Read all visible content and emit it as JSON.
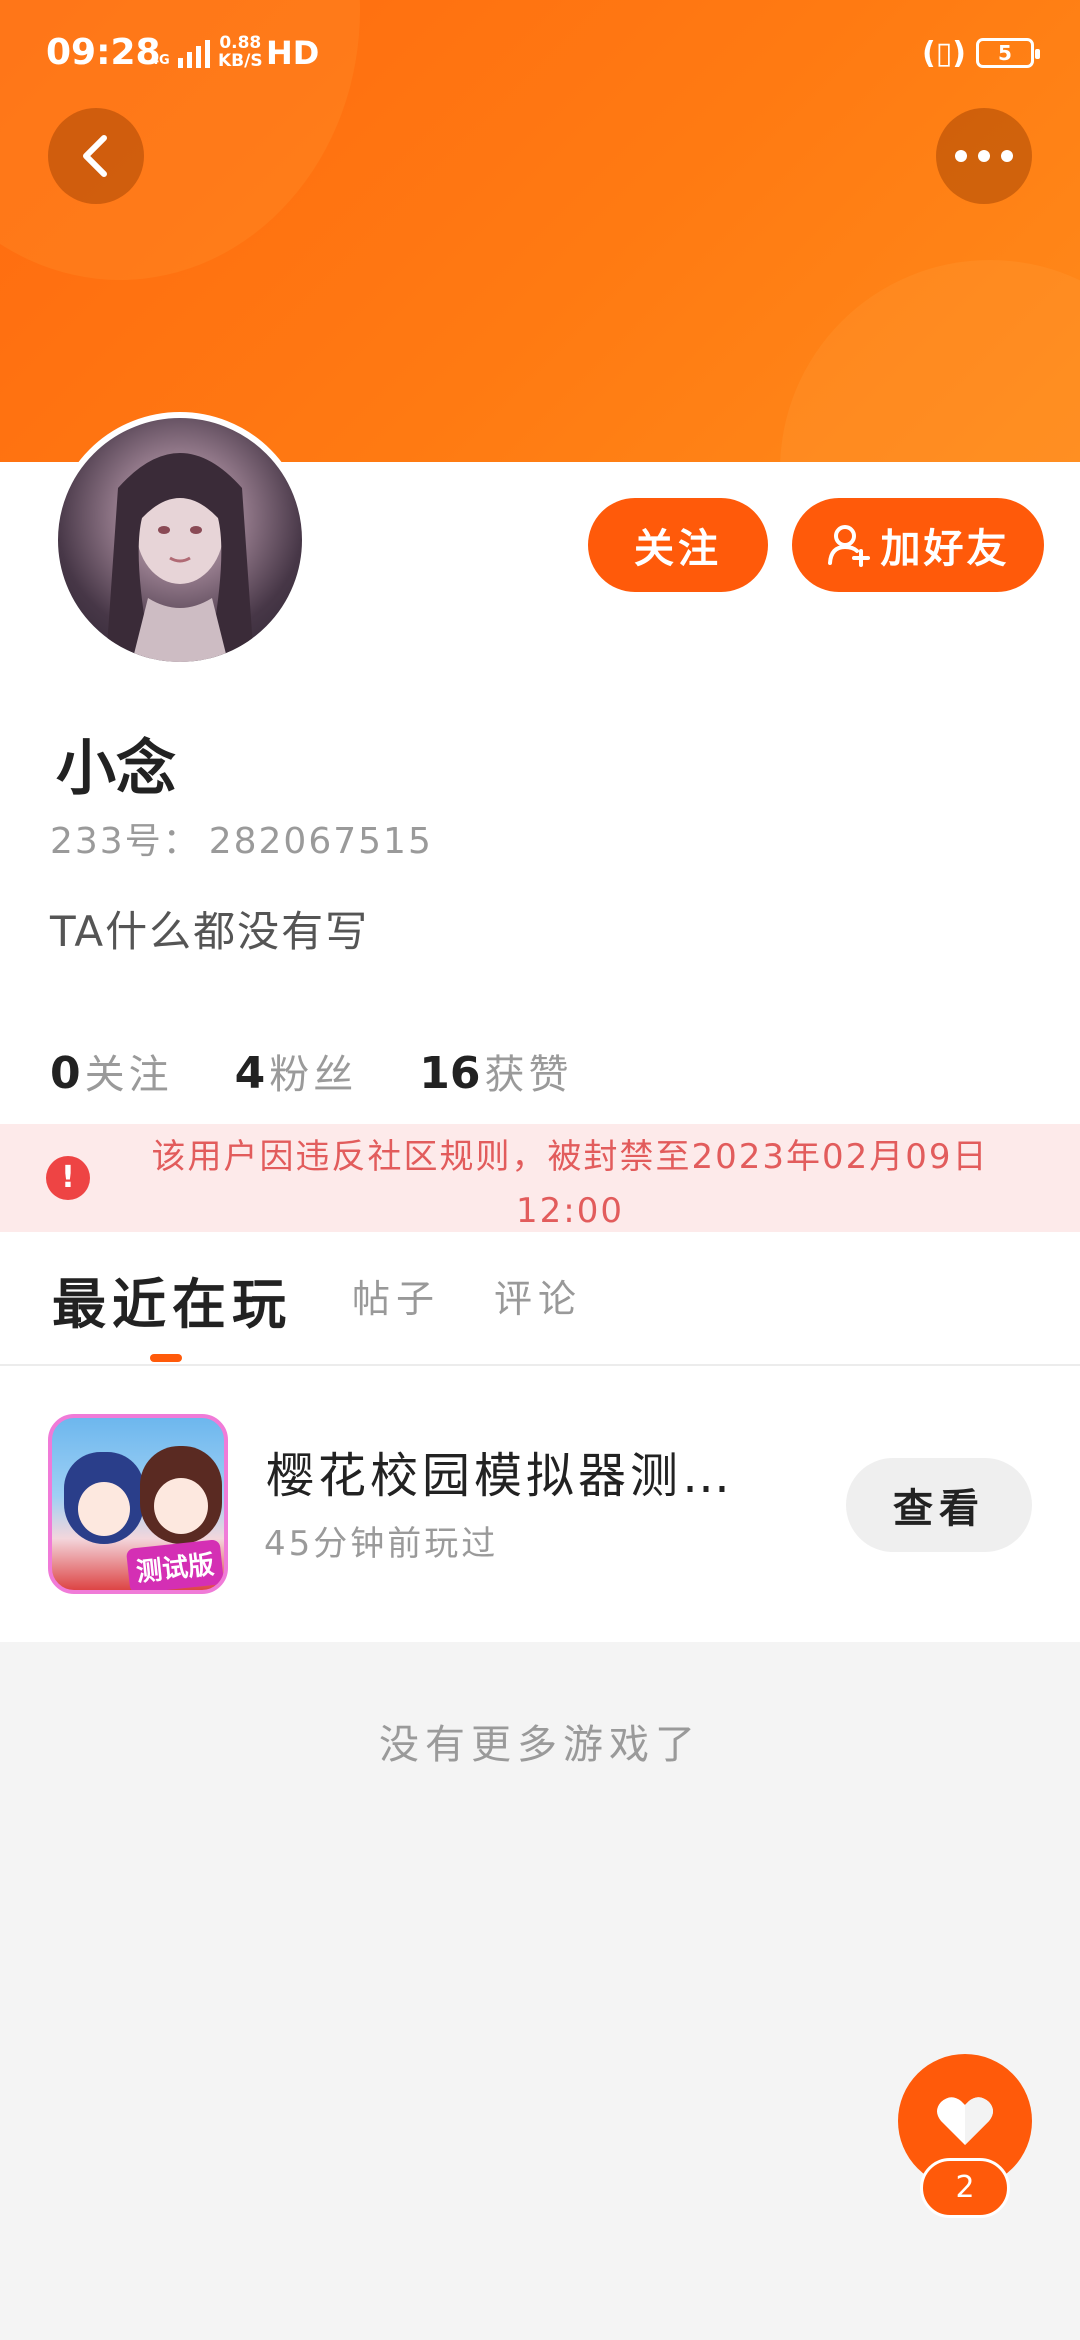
{
  "status_bar": {
    "time": "09:28",
    "network": "4G",
    "speed_value": "0.88",
    "speed_unit": "KB/S",
    "hd": "HD",
    "battery": "5"
  },
  "profile": {
    "follow_label": "关注",
    "add_friend_label": "加好友",
    "username": "小念",
    "id_label": "233号：",
    "id_value": "282067515",
    "bio": "TA什么都没有写",
    "stats": [
      {
        "num": "0",
        "label": "关注"
      },
      {
        "num": "4",
        "label": "粉丝"
      },
      {
        "num": "16",
        "label": "获赞"
      }
    ]
  },
  "ban_notice": {
    "text": "该用户因违反社区规则，被封禁至2023年02月09日 12:00",
    "icon": "exclamation-icon",
    "color": "#ee4444"
  },
  "tabs": [
    {
      "label": "最近在玩",
      "active": true
    },
    {
      "label": "帖子",
      "active": false
    },
    {
      "label": "评论",
      "active": false
    }
  ],
  "recent_game": {
    "title": "樱花校园模拟器测…",
    "played_ago": "45分钟前玩过",
    "icon_badge": "测试版",
    "view_label": "查看"
  },
  "footer": {
    "no_more": "没有更多游戏了"
  },
  "fab": {
    "icon": "heart-icon",
    "count": "2"
  },
  "colors": {
    "accent": "#ff5a0a",
    "banner": "#ff7a12",
    "ban_bg": "#fdeaea",
    "ban_text": "#e25c5c"
  }
}
